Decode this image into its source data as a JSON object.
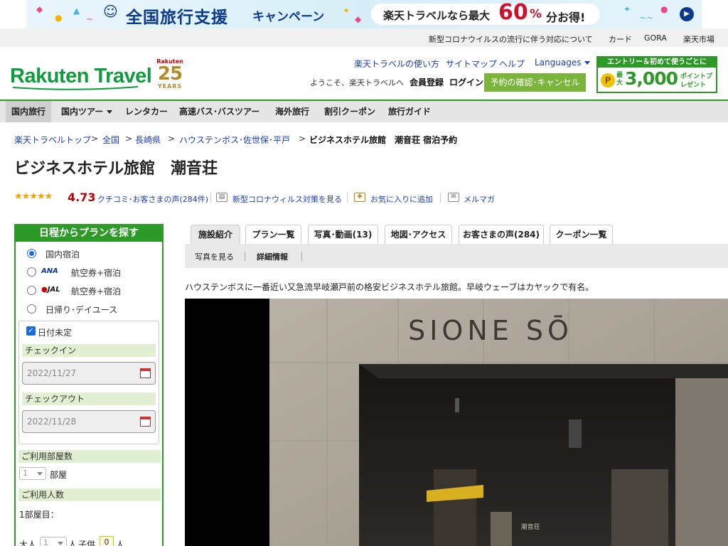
{
  "banner": {
    "title": "全国旅行支援",
    "subtitle": "キャンペーン",
    "promo_prefix": "楽天トラベルなら最大",
    "promo_value": "60",
    "promo_unit": "%",
    "promo_suffix": "分お得!"
  },
  "utility_links": [
    "新型コロナウイルスの流行に伴う対応について",
    "カード",
    "GORA",
    "楽天市場"
  ],
  "header": {
    "logo": "Rakuten Travel",
    "years_brand": "Rakuten",
    "years_number": "25",
    "years_label": "YEARS",
    "links": [
      "楽天トラベルの使い方",
      "サイトマップ",
      "ヘルプ",
      "Languages"
    ],
    "welcome": "ようこそ、楽天トラベルへ",
    "register": "会員登録",
    "login": "ログイン",
    "reserve_button": "予約の確認･キャンセル",
    "promo_top": "エントリー＆初めて使うごとに",
    "promo_coin": "P",
    "promo_max": "最大",
    "promo_points": "3,000",
    "promo_tail": "ポイントプレゼント"
  },
  "nav": [
    "国内旅行",
    "国内ツアー",
    "レンタカー",
    "高速バス･バスツアー",
    "海外旅行",
    "割引クーポン",
    "旅行ガイド"
  ],
  "breadcrumb": {
    "items": [
      "楽天トラベルトップ",
      "全国",
      "長崎県",
      "ハウステンボス･佐世保･平戸"
    ],
    "separator": ">",
    "current": "ビジネスホテル旅館　潮音荘 宿泊予約"
  },
  "hotel": {
    "name": "ビジネスホテル旅館　潮音荘",
    "stars": "★★★★★",
    "rating": "4.73",
    "rating_value": 4.73,
    "reviews_link": "クチコミ･お客さまの声(284件)",
    "covid_link": "新型コロナウィルス対策を見る",
    "favorite_link": "お気に入りに追加",
    "mailmag_link": "メルマガ",
    "description": "ハウステンボスに一番近い又急流早岐瀬戸前の格安ビジネスホテル旅館。早岐ウェーブはカヤックで有名。"
  },
  "search": {
    "header": "日程からプランを探す",
    "options": [
      {
        "label": "国内宿泊",
        "logo": "",
        "selected": true
      },
      {
        "label": "航空券+宿泊",
        "logo": "ANA",
        "selected": false
      },
      {
        "label": "航空券+宿泊",
        "logo": "JAL",
        "selected": false
      },
      {
        "label": "日帰り･デイユース",
        "logo": "",
        "selected": false
      }
    ],
    "undecided_label": "日付未定",
    "undecided_checked": true,
    "checkin_label": "チェックイン",
    "checkin_value": "2022/11/27",
    "checkout_label": "チェックアウト",
    "checkout_value": "2022/11/28",
    "rooms_label": "ご利用部屋数",
    "rooms_value": "1",
    "rooms_unit": "部屋",
    "guests_label": "ご利用人数",
    "room1_label": "1部屋目：",
    "adult_label": "大人",
    "adult_value": "1",
    "adult_unit": "人",
    "child_label": "子供",
    "child_value": "0",
    "child_unit": "人"
  },
  "tabs": [
    "施設紹介",
    "プラン一覧",
    "写真･動画(13)",
    "地図･アクセス",
    "お客さまの声(284)",
    "クーポン一覧"
  ],
  "active_tab": "施設紹介",
  "subtabs": [
    "写真を見る",
    "詳細情報"
  ],
  "photo": {
    "sign_text": "SIONE SŌ",
    "plaque_text": "潮音荘"
  },
  "colors": {
    "brand_green": "#2d9a28",
    "link_blue": "#1a3dbd",
    "rating_red": "#bf0000",
    "star_gold": "#f0a500"
  }
}
